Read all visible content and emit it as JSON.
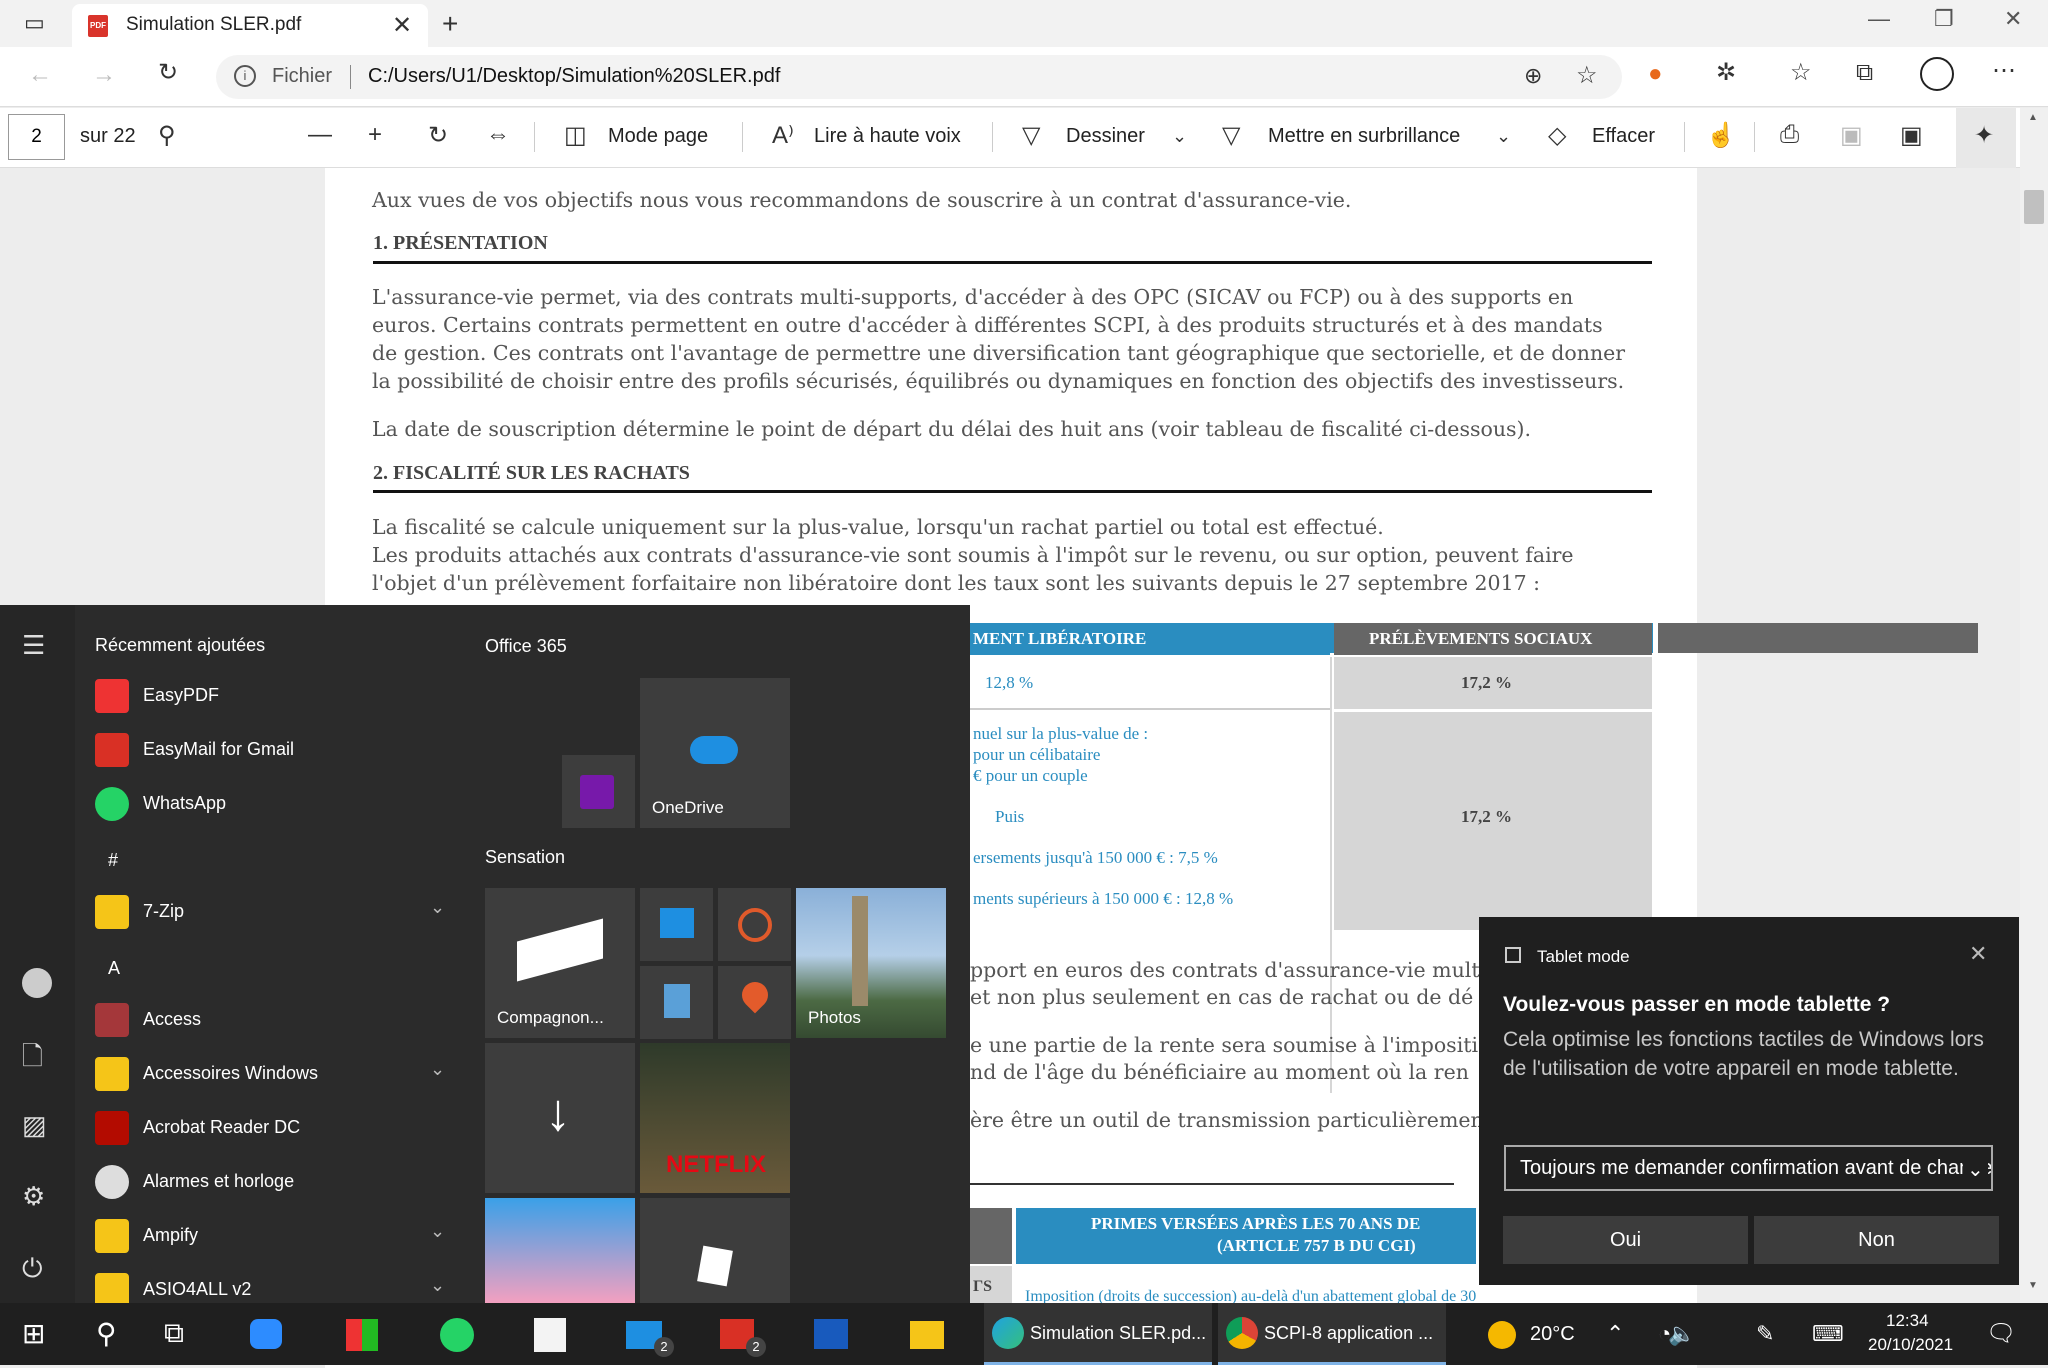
{
  "browser": {
    "tab_title": "Simulation SLER.pdf",
    "address_prefix": "Fichier",
    "url": "C:/Users/U1/Desktop/Simulation%20SLER.pdf"
  },
  "pdf_toolbar": {
    "page_value": "2",
    "page_total": "sur 22",
    "mode_page": "Mode page",
    "read_aloud": "Lire à haute voix",
    "draw": "Dessiner",
    "highlight": "Mettre en surbrillance",
    "erase": "Effacer"
  },
  "document": {
    "intro": "Aux vues de vos objectifs nous vous recommandons de souscrire à un contrat d'assurance-vie.",
    "h1": "1. PRÉSENTATION",
    "p1_l1": "L'assurance-vie permet, via des contrats multi-supports, d'accéder à des OPC (SICAV ou FCP) ou à des supports en",
    "p1_l2": "euros. Certains contrats permettent en outre d'accéder à différentes SCPI, à des produits structurés et à des mandats",
    "p1_l3": "de gestion. Ces contrats ont l'avantage de permettre une diversification tant géographique que sectorielle, et de donner",
    "p1_l4": "la possibilité de choisir entre des profils sécurisés, équilibrés ou dynamiques en fonction des objectifs des investisseurs.",
    "p2": "La date de souscription détermine le point de départ du délai des huit ans (voir tableau de fiscalité ci-dessous).",
    "h2": "2. FISCALITÉ SUR LES RACHATS",
    "p3_l1": "La fiscalité se calcule uniquement sur la plus-value, lorsqu'un rachat partiel ou total est effectué.",
    "p3_l2": "Les produits attachés aux contrats d'assurance-vie sont soumis à l'impôt sur le revenu, ou sur option, peuvent faire",
    "p3_l3": "l'objet d'un prélèvement forfaitaire non libératoire dont les taux sont les suivants depuis le 27 septembre 2017 :",
    "table_h1": "MENT LIBÉRATOIRE",
    "table_h2": "PRÉLÈVEMENTS SOCIAUX",
    "r1c1": "12,8 %",
    "r1c2": "17,2 %",
    "r2_l1": "nuel sur la plus-value de :",
    "r2_l2": "pour un célibataire",
    "r2_l3": "€ pour un couple",
    "r2_l4": "Puis",
    "r2_l5": "ersements jusqu'à 150 000 € : 7,5 %",
    "r2_l6": "ments supérieurs à 150 000 € : 12,8 %",
    "r2c2": "17,2 %",
    "p4_l1": "pport en euros des contrats d'assurance-vie mult",
    "p4_l2": "et non plus seulement en cas de rachat ou de dé",
    "p5_l1": "e une partie de la rente sera soumise à l'impositi",
    "p5_l2": "nd de l'âge du bénéficiaire au moment où la ren",
    "p6": "ère être un outil de transmission particulièremen",
    "table2_h": "PRIMES VERSÉES APRÈS LES 70 ANS DE",
    "table2_h2": "(ARTICLE 757 B DU CGI)",
    "table2_left": "ΓS",
    "table2_row": "Imposition (droits de succession) au-delà d'un abattement global de 30"
  },
  "start_menu": {
    "recent_header": "Récemment ajoutées",
    "recent": [
      "EasyPDF",
      "EasyMail for Gmail",
      "WhatsApp"
    ],
    "hash": "#",
    "seven_zip": "7-Zip",
    "letter_a": "A",
    "a_apps": [
      "Access",
      "Accessoires Windows",
      "Acrobat Reader DC",
      "Alarmes et horloge",
      "Ampify",
      "ASIO4ALL v2"
    ],
    "group1": "Office 365",
    "onedrive": "OneDrive",
    "group2": "Sensation",
    "companion": "Compagnon...",
    "photos": "Photos",
    "netflix": "NETFLIX"
  },
  "toast": {
    "header": "Tablet mode",
    "question": "Voulez-vous passer en mode tablette ?",
    "body": "Cela optimise les fonctions tactiles de Windows lors de l'utilisation de votre appareil en mode tablette.",
    "select_value": "Toujours me demander confirmation avant de changer",
    "yes": "Oui",
    "no": "Non"
  },
  "taskbar": {
    "edge_label": "Simulation SLER.pd...",
    "chrome_label": "SCPI-8 application ...",
    "badge_mail": "2",
    "badge_gmail": "2",
    "weather": "20°C",
    "time": "12:34",
    "date": "20/10/2021"
  },
  "colors": {
    "accent_blue": "#2a8dc0",
    "table_header_blue": "#2a8dc0",
    "table_header_gray": "#666666",
    "start_bg": "#2b2b2b",
    "taskbar_bg": "#1f1f1f"
  }
}
